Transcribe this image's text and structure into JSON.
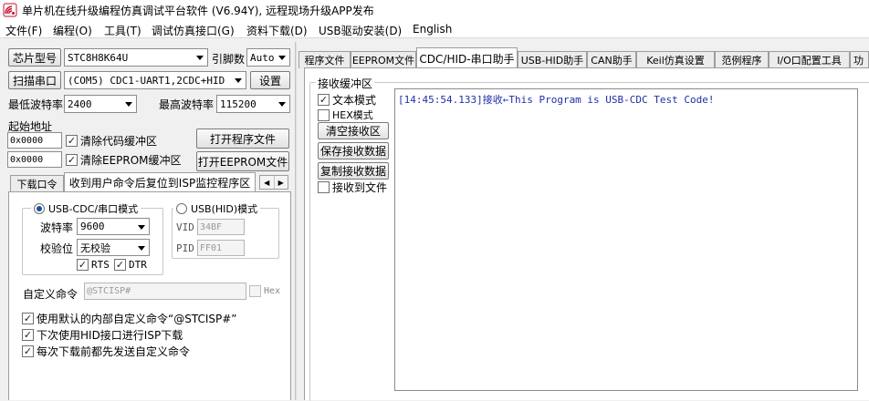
{
  "window": {
    "title": "单片机在线升级编程仿真调试平台软件 (V6.94Y), 远程现场升级APP发布",
    "icon": "app-icon"
  },
  "menu": [
    "文件(F)",
    "编程(O)",
    "工具(T)",
    "调试仿真接口(G)",
    "资料下载(D)",
    "USB驱动安装(D)",
    "English"
  ],
  "left": {
    "chip_button": "芯片型号",
    "chip_value": "STC8H8K64U",
    "pins_label": "引脚数",
    "pins_value": "Auto",
    "scan_button": "扫描串口",
    "port_value": "(COM5) CDC1-UART1,2CDC+HID",
    "settings_button": "设置",
    "min_baud_label": "最低波特率",
    "min_baud_value": "2400",
    "max_baud_label": "最高波特率",
    "max_baud_value": "115200",
    "start_addr_label": "起始地址",
    "addr1": "0x0000",
    "clear_code": "清除代码缓冲区",
    "open_program": "打开程序文件",
    "addr2": "0x0000",
    "clear_eeprom": "清除EEPROM缓冲区",
    "open_eeprom": "打开EEPROM文件",
    "tabs": [
      "下载口令",
      "收到用户命令后复位到ISP监控程序区"
    ],
    "cdc_mode": "USB-CDC/串口模式",
    "hid_mode": "USB(HID)模式",
    "baud_label": "波特率",
    "baud_value": "9600",
    "parity_label": "校验位",
    "parity_value": "无校验",
    "rts": "RTS",
    "dtr": "DTR",
    "vid_label": "VID",
    "vid_value": "34BF",
    "pid_label": "PID",
    "pid_value": "FF01",
    "custom_cmd_label": "自定义命令",
    "custom_cmd_value": "@STCISP#",
    "hex_label": "Hex",
    "opt1": "使用默认的内部自定义命令“@STCISP#”",
    "opt2": "下次使用HID接口进行ISP下载",
    "opt3": "每次下载前都先发送自定义命令"
  },
  "right": {
    "tabs": [
      "程序文件",
      "EEPROM文件",
      "CDC/HID-串口助手",
      "USB-HID助手",
      "CAN助手",
      "Keil仿真设置",
      "范例程序",
      "I/O口配置工具",
      "功"
    ],
    "recv_group": "接收缓冲区",
    "text_mode": "文本模式",
    "hex_mode": "HEX模式",
    "clear_recv": "清空接收区",
    "save_recv": "保存接收数据",
    "copy_recv": "复制接收数据",
    "recv_to_file": "接收到文件",
    "log_line": "[14:45:54.133]接收←This Program is USB-CDC Test Code!"
  },
  "colors": {
    "log_text": "#1f2fa8",
    "accent": "#1b4fa0"
  }
}
